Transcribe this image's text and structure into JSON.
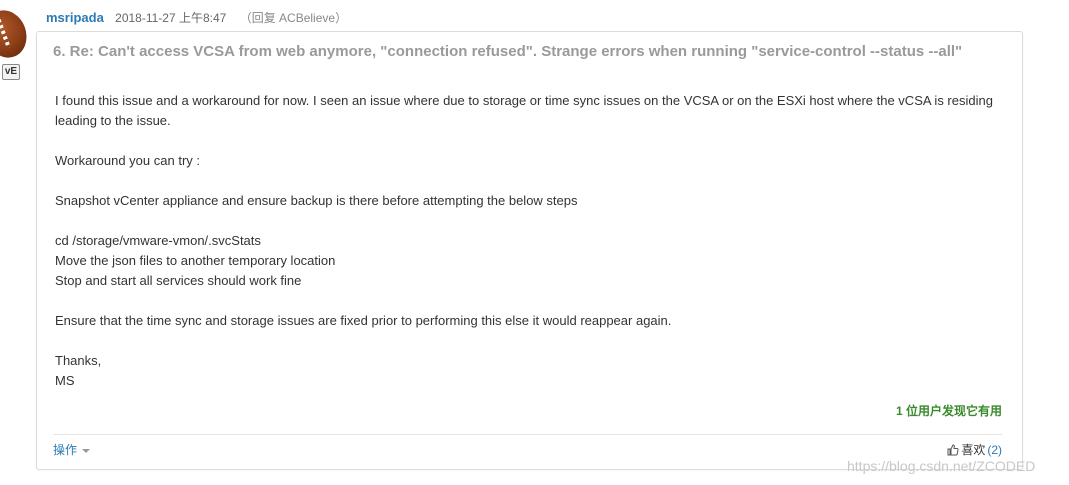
{
  "author": {
    "name": "msripada",
    "date": "2018-11-27 上午8:47",
    "reply_prefix": "（回复",
    "reply_user": "ACBelieve",
    "reply_suffix": "）",
    "badge": "vE"
  },
  "post": {
    "title": "6. Re: Can't access VCSA from web anymore, \"connection refused\". Strange errors when running \"service-control --status --all\"",
    "paragraph1": "I found this issue and a workaround for now. I seen an issue where due to storage or time sync issues on the VCSA or on the ESXi host where the vCSA is residing leading to the issue.",
    "paragraph2": "Workaround you can try :",
    "paragraph3": "Snapshot vCenter appliance and ensure backup is there before attempting the below steps",
    "steps": [
      "cd /storage/vmware-vmon/.svcStats",
      "Move the json files to another temporary location",
      "Stop and start all services should work fine"
    ],
    "paragraph4": "Ensure that the time sync and storage issues are fixed prior to performing this else it would reappear again.",
    "closing": "Thanks,",
    "signature": "MS"
  },
  "footer": {
    "helpful": "1 位用户发现它有用",
    "actions_label": "操作",
    "like_label": "喜欢",
    "like_count": "(2)"
  },
  "watermark": "https://blog.csdn.net/ZCODED",
  "colors": {
    "link": "#2c7ab5",
    "helpful": "#3a8a2e",
    "title": "#9a9a9a"
  }
}
